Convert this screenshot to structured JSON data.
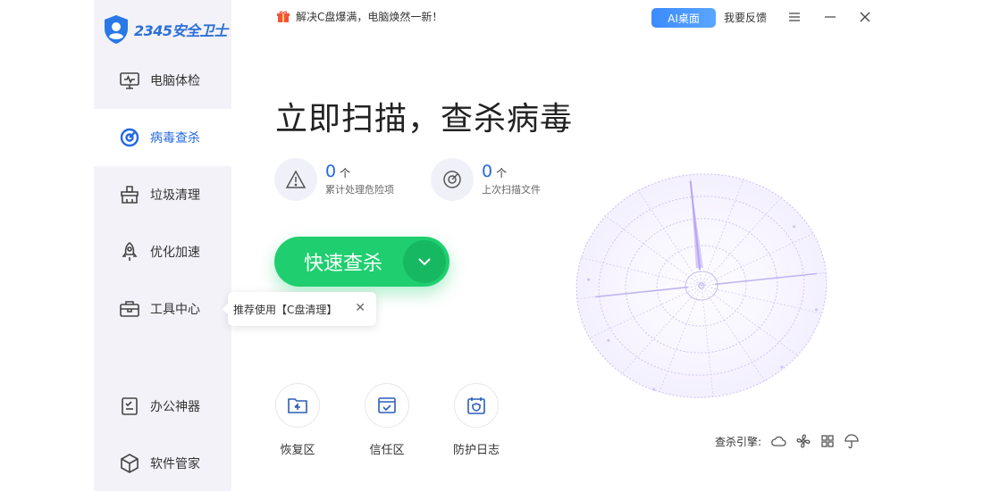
{
  "app": {
    "logo_text": "2345安全卫士"
  },
  "sidebar": {
    "items": [
      {
        "label": "电脑体检"
      },
      {
        "label": "病毒查杀"
      },
      {
        "label": "垃圾清理"
      },
      {
        "label": "优化加速"
      },
      {
        "label": "工具中心"
      },
      {
        "label": "办公神器"
      },
      {
        "label": "软件管家"
      }
    ]
  },
  "topbar": {
    "notice": "解决C盘爆满，电脑焕然一新！",
    "ai_button": "AI桌面",
    "feedback": "我要反馈"
  },
  "main": {
    "headline": "立即扫描，查杀病毒",
    "stats": [
      {
        "value": "0",
        "unit": "个",
        "desc": "累计处理危险项"
      },
      {
        "value": "0",
        "unit": "个",
        "desc": "上次扫描文件"
      }
    ],
    "scan_button": "快速查杀",
    "tooltip": "推荐使用【C盘清理】",
    "tools": [
      {
        "label": "恢复区"
      },
      {
        "label": "信任区"
      },
      {
        "label": "防护日志"
      }
    ],
    "engine_label": "查杀引擎:"
  },
  "colors": {
    "accent": "#2468e0",
    "scan_green": "#1fcf6f",
    "sidebar_bg": "#f3f2f9"
  }
}
